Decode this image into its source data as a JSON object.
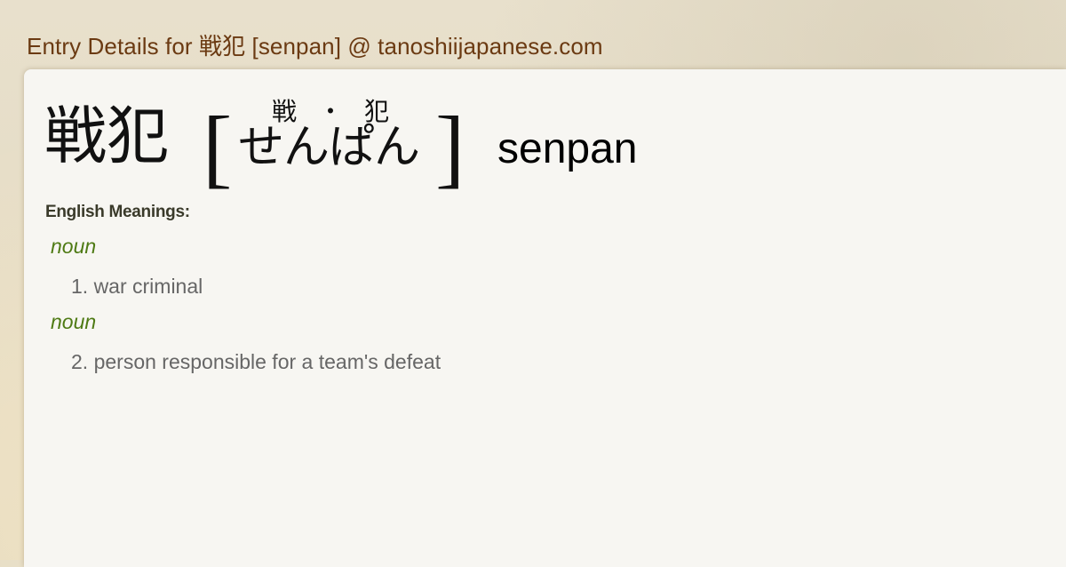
{
  "page": {
    "title": "Entry Details for 戦犯 [senpan] @ tanoshiijapanese.com"
  },
  "entry": {
    "kanji": "戦犯",
    "bracket_open": "[",
    "bracket_close": "]",
    "furigana": [
      "戦",
      "・",
      "犯"
    ],
    "kana": "せんぱん",
    "romaji": "senpan"
  },
  "meanings": {
    "label": "English Meanings:",
    "items": [
      {
        "pos": "noun",
        "text": "1. war criminal"
      },
      {
        "pos": "noun",
        "text": "2. person responsible for a team's defeat"
      }
    ]
  },
  "colors": {
    "title": "#6b3a12",
    "pos": "#4e7a14",
    "meaning": "#666666"
  }
}
